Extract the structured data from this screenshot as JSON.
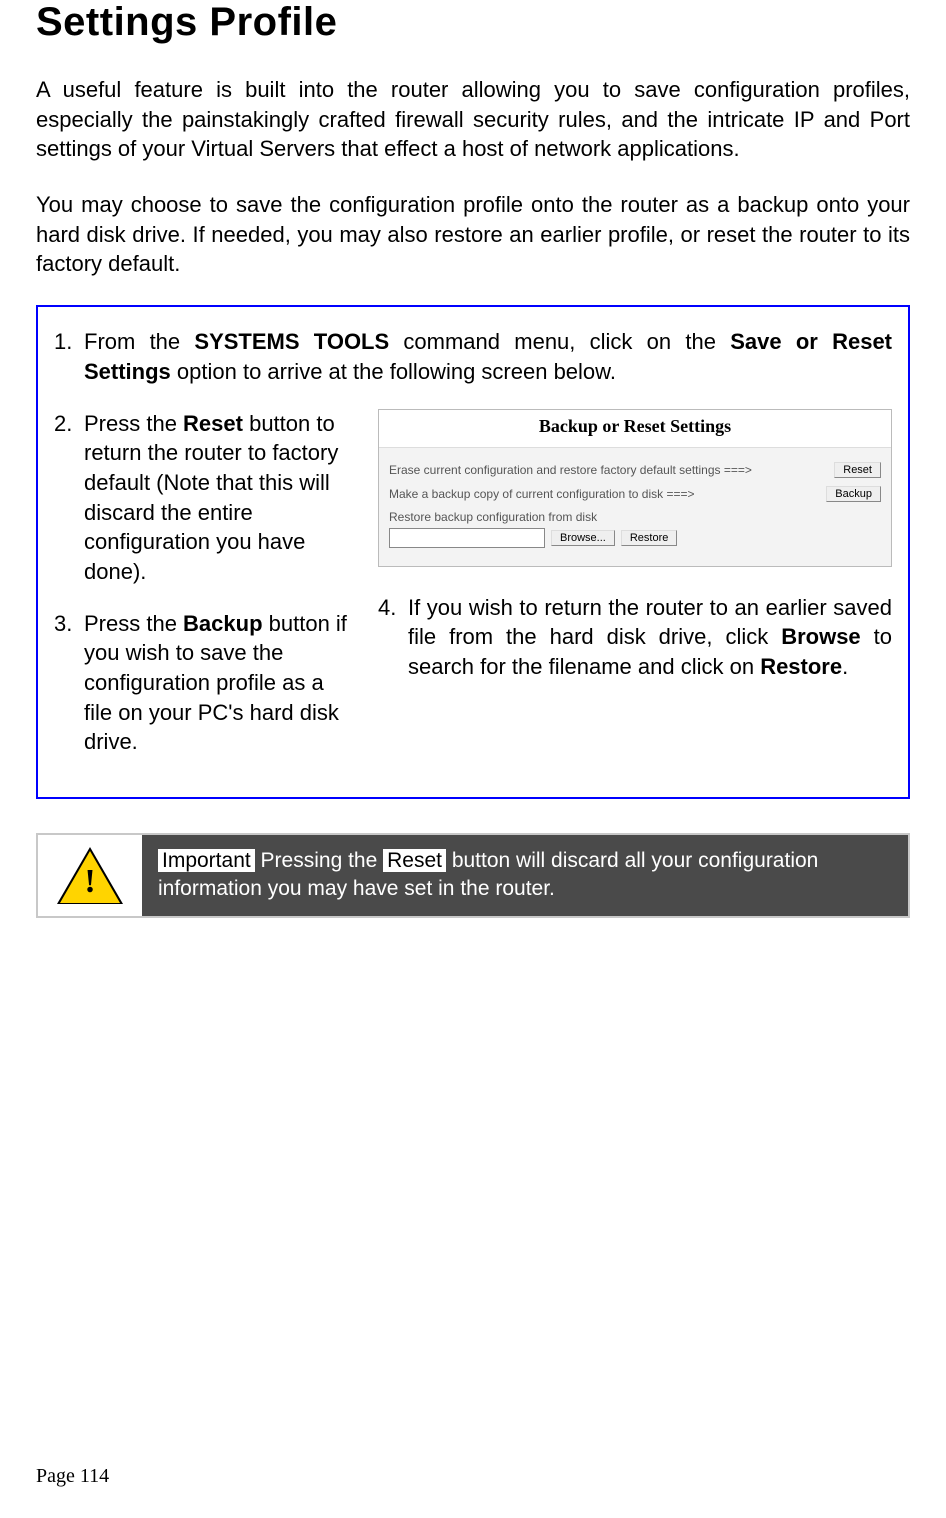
{
  "title": "Settings Profile",
  "intro_p1": "A useful feature is built into the router allowing you to save configuration profiles, especially the painstakingly crafted firewall security rules, and the intricate IP and Port settings of your Virtual Servers that effect a host of network applications.",
  "intro_p2": "You may choose to save the configuration profile onto the router as a backup onto your hard disk drive. If needed, you may also restore an earlier profile, or reset the router to its factory default.",
  "step1_num": "1.",
  "step1_pre": "From the ",
  "step1_b1": "SYSTEMS TOOLS",
  "step1_mid": " command menu, click on the ",
  "step1_b2": "Save or Reset Settings",
  "step1_post": " option to arrive at the following screen below.",
  "step2_num": "2.",
  "step2_pre": "Press the ",
  "step2_b": "Reset",
  "step2_post": " button to return the router to factory default (Note that this will discard the entire configuration you have done).",
  "step3_num": "3.",
  "step3_pre": "Press the ",
  "step3_b": "Backup",
  "step3_post": " button if you wish to save the configuration profile as a file on your PC's hard disk drive.",
  "step4_num": "4.",
  "step4_pre": "If you wish to return the router to an earlier saved file from the hard disk drive, click ",
  "step4_b1": "Browse",
  "step4_mid": " to search for the filename and click on ",
  "step4_b2": "Restore",
  "step4_post": ".",
  "shot_header": "Backup or Reset Settings",
  "shot_row1": "Erase current configuration and restore factory default settings ===>",
  "shot_row2": "Make a backup copy of current configuration to disk ===>",
  "shot_row3": "Restore backup configuration from disk",
  "shot_btn_reset": "Reset",
  "shot_btn_backup": "Backup",
  "shot_btn_browse": "Browse...",
  "shot_btn_restore": "Restore",
  "warn_label": "Important",
  "warn_pre": " Pressing the ",
  "warn_b": "Reset",
  "warn_post": " button will discard all your configuration information you may have set in the router.",
  "warn_bang": "!",
  "page_footer": "Page 114"
}
